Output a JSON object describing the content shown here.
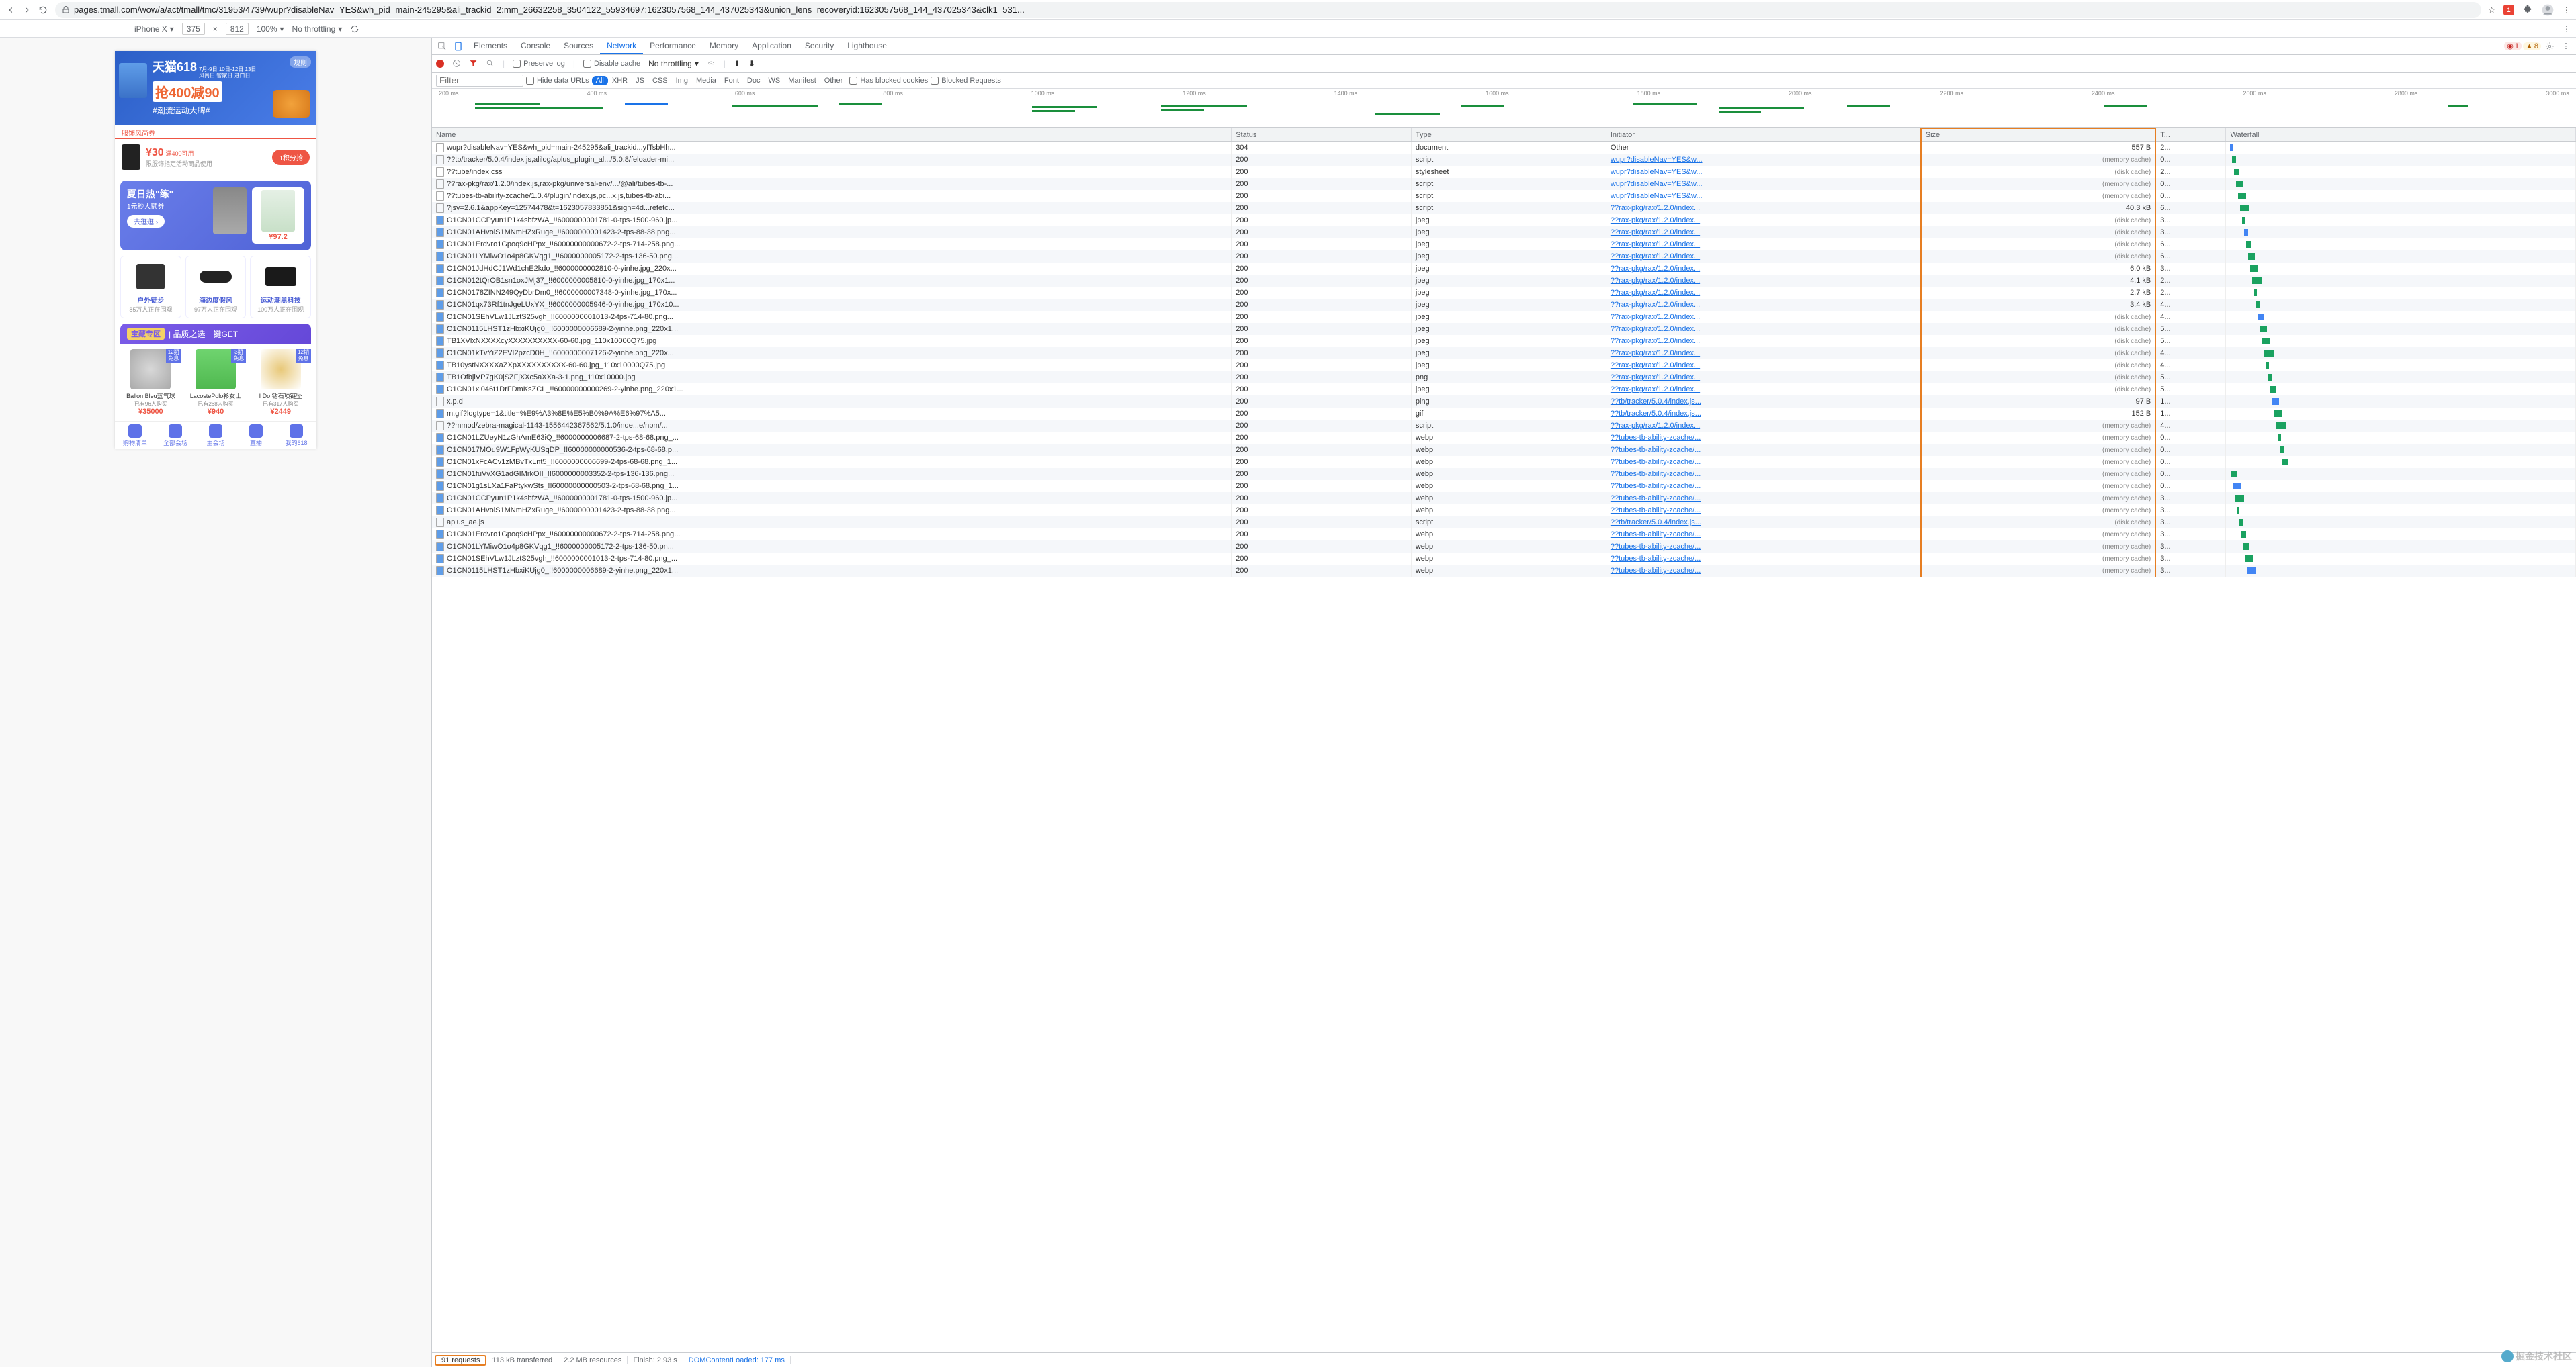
{
  "browser": {
    "url": "pages.tmall.com/wow/a/act/tmall/tmc/31953/4739/wupr?disableNav=YES&wh_pid=main-245295&ali_trackid=2:mm_26632258_3504122_55934697:1623057568_144_437025343&union_lens=recoveryid:1623057568_144_437025343&clk1=531...",
    "ext_badge": "1"
  },
  "device_bar": {
    "device": "iPhone X",
    "width": "375",
    "height": "812",
    "zoom": "100%",
    "throttling": "No throttling"
  },
  "devtools": {
    "tabs": [
      "Elements",
      "Console",
      "Sources",
      "Network",
      "Performance",
      "Memory",
      "Application",
      "Security",
      "Lighthouse"
    ],
    "active_tab": "Network",
    "errors": "1",
    "warnings": "8",
    "preserve_log": "Preserve log",
    "disable_cache": "Disable cache",
    "throttling": "No throttling",
    "hide_data_urls": "Hide data URLs",
    "filter_types": [
      "All",
      "XHR",
      "JS",
      "CSS",
      "Img",
      "Media",
      "Font",
      "Doc",
      "WS",
      "Manifest",
      "Other"
    ],
    "has_blocked": "Has blocked cookies",
    "blocked_req": "Blocked Requests",
    "filter_placeholder": "Filter"
  },
  "overview_ticks": [
    "200 ms",
    "400 ms",
    "600 ms",
    "800 ms",
    "1000 ms",
    "1200 ms",
    "1400 ms",
    "1600 ms",
    "1800 ms",
    "2000 ms",
    "2200 ms",
    "2400 ms",
    "2600 ms",
    "2800 ms",
    "3000 ms"
  ],
  "columns": {
    "name": "Name",
    "status": "Status",
    "type": "Type",
    "initiator": "Initiator",
    "size": "Size",
    "time": "T...",
    "waterfall": "Waterfall"
  },
  "rows": [
    {
      "name": "wupr?disableNav=YES&wh_pid=main-245295&ali_trackid...yfTsbHh...",
      "status": "304",
      "type": "document",
      "init": "Other",
      "init_link": false,
      "size": "557 B",
      "time": "2...",
      "icon": ""
    },
    {
      "name": "??tb/tracker/5.0.4/index.js,alilog/aplus_plugin_al.../5.0.8/feloader-mi...",
      "status": "200",
      "type": "script",
      "init": "wupr?disableNav=YES&w...",
      "init_link": true,
      "size": "(memory cache)",
      "time": "0...",
      "icon": ""
    },
    {
      "name": "??tube/index.css",
      "status": "200",
      "type": "stylesheet",
      "init": "wupr?disableNav=YES&w...",
      "init_link": true,
      "size": "(disk cache)",
      "time": "2...",
      "icon": ""
    },
    {
      "name": "??rax-pkg/rax/1.2.0/index.js,rax-pkg/universal-env/.../@ali/tubes-tb-...",
      "status": "200",
      "type": "script",
      "init": "wupr?disableNav=YES&w...",
      "init_link": true,
      "size": "(memory cache)",
      "time": "0...",
      "icon": ""
    },
    {
      "name": "??tubes-tb-ability-zcache/1.0.4/plugin/index.js,pc...x.js,tubes-tb-abi...",
      "status": "200",
      "type": "script",
      "init": "wupr?disableNav=YES&w...",
      "init_link": true,
      "size": "(memory cache)",
      "time": "0...",
      "icon": ""
    },
    {
      "name": "?jsv=2.6.1&appKey=12574478&t=1623057833851&sign=4d...refetc...",
      "status": "200",
      "type": "script",
      "init": "??rax-pkg/rax/1.2.0/index...",
      "init_link": true,
      "size": "40.3 kB",
      "time": "6...",
      "icon": ""
    },
    {
      "name": "O1CN01CCPyun1P1k4sbfzWA_!!6000000001781-0-tps-1500-960.jp...",
      "status": "200",
      "type": "jpeg",
      "init": "??rax-pkg/rax/1.2.0/index...",
      "init_link": true,
      "size": "(disk cache)",
      "time": "3...",
      "icon": "img"
    },
    {
      "name": "O1CN01AHvolS1MNmHZxRuge_!!6000000001423-2-tps-88-38.png...",
      "status": "200",
      "type": "jpeg",
      "init": "??rax-pkg/rax/1.2.0/index...",
      "init_link": true,
      "size": "(disk cache)",
      "time": "3...",
      "icon": "img"
    },
    {
      "name": "O1CN01Erdvro1Gpoq9cHPpx_!!60000000000672-2-tps-714-258.png...",
      "status": "200",
      "type": "jpeg",
      "init": "??rax-pkg/rax/1.2.0/index...",
      "init_link": true,
      "size": "(disk cache)",
      "time": "6...",
      "icon": "img"
    },
    {
      "name": "O1CN01LYMiwO1o4p8GKVqg1_!!6000000005172-2-tps-136-50.png...",
      "status": "200",
      "type": "jpeg",
      "init": "??rax-pkg/rax/1.2.0/index...",
      "init_link": true,
      "size": "(disk cache)",
      "time": "6...",
      "icon": "img"
    },
    {
      "name": "O1CN01JdHdCJ1Wd1chE2kdo_!!6000000002810-0-yinhe.jpg_220x...",
      "status": "200",
      "type": "jpeg",
      "init": "??rax-pkg/rax/1.2.0/index...",
      "init_link": true,
      "size": "6.0 kB",
      "time": "3...",
      "icon": "img"
    },
    {
      "name": "O1CN012tQrOB1sn1oxJMj37_!!6000000005810-0-yinhe.jpg_170x1...",
      "status": "200",
      "type": "jpeg",
      "init": "??rax-pkg/rax/1.2.0/index...",
      "init_link": true,
      "size": "4.1 kB",
      "time": "2...",
      "icon": "img"
    },
    {
      "name": "O1CN0178ZINN249QyDbrDm0_!!6000000007348-0-yinhe.jpg_170x...",
      "status": "200",
      "type": "jpeg",
      "init": "??rax-pkg/rax/1.2.0/index...",
      "init_link": true,
      "size": "2.7 kB",
      "time": "2...",
      "icon": "img"
    },
    {
      "name": "O1CN01qx73Rf1tnJgeLUxYX_!!6000000005946-0-yinhe.jpg_170x10...",
      "status": "200",
      "type": "jpeg",
      "init": "??rax-pkg/rax/1.2.0/index...",
      "init_link": true,
      "size": "3.4 kB",
      "time": "4...",
      "icon": "img"
    },
    {
      "name": "O1CN01SEhVLw1JLztS25vgh_!!6000000001013-2-tps-714-80.png...",
      "status": "200",
      "type": "jpeg",
      "init": "??rax-pkg/rax/1.2.0/index...",
      "init_link": true,
      "size": "(disk cache)",
      "time": "4...",
      "icon": "img"
    },
    {
      "name": "O1CN0115LHST1zHbxiKUjg0_!!6000000006689-2-yinhe.png_220x1...",
      "status": "200",
      "type": "jpeg",
      "init": "??rax-pkg/rax/1.2.0/index...",
      "init_link": true,
      "size": "(disk cache)",
      "time": "5...",
      "icon": "img"
    },
    {
      "name": "TB1XVlxNXXXXcyXXXXXXXXXX-60-60.jpg_110x10000Q75.jpg",
      "status": "200",
      "type": "jpeg",
      "init": "??rax-pkg/rax/1.2.0/index...",
      "init_link": true,
      "size": "(disk cache)",
      "time": "5...",
      "icon": "img"
    },
    {
      "name": "O1CN01kTvYiZ2EVI2pzcD0H_!!6000000007126-2-yinhe.png_220x...",
      "status": "200",
      "type": "jpeg",
      "init": "??rax-pkg/rax/1.2.0/index...",
      "init_link": true,
      "size": "(disk cache)",
      "time": "4...",
      "icon": "img"
    },
    {
      "name": "TB10ystNXXXXaZXpXXXXXXXXXX-60-60.jpg_110x10000Q75.jpg",
      "status": "200",
      "type": "jpeg",
      "init": "??rax-pkg/rax/1.2.0/index...",
      "init_link": true,
      "size": "(disk cache)",
      "time": "4...",
      "icon": "img"
    },
    {
      "name": "TB1OfbjiVP7gK0jSZFjXXc5aXXa-3-1.png_110x10000.jpg",
      "status": "200",
      "type": "png",
      "init": "??rax-pkg/rax/1.2.0/index...",
      "init_link": true,
      "size": "(disk cache)",
      "time": "5...",
      "icon": "img"
    },
    {
      "name": "O1CN01xi046t1DrFDmKsZCL_!!60000000000269-2-yinhe.png_220x1...",
      "status": "200",
      "type": "jpeg",
      "init": "??rax-pkg/rax/1.2.0/index...",
      "init_link": true,
      "size": "(disk cache)",
      "time": "5...",
      "icon": "img"
    },
    {
      "name": "x.p.d",
      "status": "200",
      "type": "ping",
      "init": "??tb/tracker/5.0.4/index.js...",
      "init_link": true,
      "size": "97 B",
      "time": "1...",
      "icon": ""
    },
    {
      "name": "m.gif?logtype=1&title=%E9%A3%8E%E5%B0%9A%E6%97%A5...",
      "status": "200",
      "type": "gif",
      "init": "??tb/tracker/5.0.4/index.js...",
      "init_link": true,
      "size": "152 B",
      "time": "1...",
      "icon": "img"
    },
    {
      "name": "??mmod/zebra-magical-1143-1556442367562/5.1.0/inde...e/npm/...",
      "status": "200",
      "type": "script",
      "init": "??rax-pkg/rax/1.2.0/index...",
      "init_link": true,
      "size": "(memory cache)",
      "time": "4...",
      "icon": ""
    },
    {
      "name": "O1CN01LZUeyN1zGhAmE63iQ_!!6000000006687-2-tps-68-68.png_...",
      "status": "200",
      "type": "webp",
      "init": "??tubes-tb-ability-zcache/...",
      "init_link": true,
      "size": "(memory cache)",
      "time": "0...",
      "icon": "img"
    },
    {
      "name": "O1CN017MOu9W1FpWyKUSqDP_!!60000000000536-2-tps-68-68.p...",
      "status": "200",
      "type": "webp",
      "init": "??tubes-tb-ability-zcache/...",
      "init_link": true,
      "size": "(memory cache)",
      "time": "0...",
      "icon": "img"
    },
    {
      "name": "O1CN01xFcACv1zMBvTxLnt5_!!6000000006699-2-tps-68-68.png_1...",
      "status": "200",
      "type": "webp",
      "init": "??tubes-tb-ability-zcache/...",
      "init_link": true,
      "size": "(memory cache)",
      "time": "0...",
      "icon": "img"
    },
    {
      "name": "O1CN01fuVvXG1adGIMrkOII_!!6000000003352-2-tps-136-136.png...",
      "status": "200",
      "type": "webp",
      "init": "??tubes-tb-ability-zcache/...",
      "init_link": true,
      "size": "(memory cache)",
      "time": "0...",
      "icon": "img"
    },
    {
      "name": "O1CN01g1sLXa1FaPtykwSts_!!60000000000503-2-tps-68-68.png_1...",
      "status": "200",
      "type": "webp",
      "init": "??tubes-tb-ability-zcache/...",
      "init_link": true,
      "size": "(memory cache)",
      "time": "0...",
      "icon": "img"
    },
    {
      "name": "O1CN01CCPyun1P1k4sbfzWA_!!6000000001781-0-tps-1500-960.jp...",
      "status": "200",
      "type": "webp",
      "init": "??tubes-tb-ability-zcache/...",
      "init_link": true,
      "size": "(memory cache)",
      "time": "3...",
      "icon": "img"
    },
    {
      "name": "O1CN01AHvolS1MNmHZxRuge_!!6000000001423-2-tps-88-38.png...",
      "status": "200",
      "type": "webp",
      "init": "??tubes-tb-ability-zcache/...",
      "init_link": true,
      "size": "(memory cache)",
      "time": "3...",
      "icon": "img"
    },
    {
      "name": "aplus_ae.js",
      "status": "200",
      "type": "script",
      "init": "??tb/tracker/5.0.4/index.js...",
      "init_link": true,
      "size": "(disk cache)",
      "time": "3...",
      "icon": ""
    },
    {
      "name": "O1CN01Erdvro1Gpoq9cHPpx_!!60000000000672-2-tps-714-258.png...",
      "status": "200",
      "type": "webp",
      "init": "??tubes-tb-ability-zcache/...",
      "init_link": true,
      "size": "(memory cache)",
      "time": "3...",
      "icon": "img"
    },
    {
      "name": "O1CN01LYMiwO1o4p8GKVqg1_!!6000000005172-2-tps-136-50.pn...",
      "status": "200",
      "type": "webp",
      "init": "??tubes-tb-ability-zcache/...",
      "init_link": true,
      "size": "(memory cache)",
      "time": "3...",
      "icon": "img"
    },
    {
      "name": "O1CN01SEhVLw1JLztS25vgh_!!6000000001013-2-tps-714-80.png_...",
      "status": "200",
      "type": "webp",
      "init": "??tubes-tb-ability-zcache/...",
      "init_link": true,
      "size": "(memory cache)",
      "time": "3...",
      "icon": "img"
    },
    {
      "name": "O1CN0115LHST1zHbxiKUjg0_!!6000000006689-2-yinhe.png_220x1...",
      "status": "200",
      "type": "webp",
      "init": "??tubes-tb-ability-zcache/...",
      "init_link": true,
      "size": "(memory cache)",
      "time": "3...",
      "icon": "img"
    }
  ],
  "status_bar": {
    "requests": "91 requests",
    "transferred": "113 kB transferred",
    "resources": "2.2 MB resources",
    "finish": "Finish: 2.93 s",
    "dom": "DOMContentLoaded: 177 ms"
  },
  "phone": {
    "banner": {
      "rules": "规则",
      "logo": "天猫618",
      "dates": "7月-9日 10日-12日 13日",
      "sub_dates": "风尚日 智家日 进口日",
      "main": "抢400减90",
      "tag": "#潮流运动大牌#"
    },
    "coupon": {
      "tag": "服饰风尚券",
      "price": "¥30",
      "cond": "满400可用",
      "desc": "限服饰指定活动商品使用",
      "btn": "1积分抢"
    },
    "training": {
      "title": "夏日热\"练\"",
      "sub": "1元秒大额券",
      "go": "去逛逛 ›",
      "price": "¥97.2"
    },
    "cats": [
      {
        "title": "户外徒步",
        "sub": "85万人正在围观"
      },
      {
        "title": "海边度假风",
        "sub": "97万人正在围观"
      },
      {
        "title": "运动潮黑科技",
        "sub": "100万人正在围观"
      }
    ],
    "treasure": {
      "badge": "宝藏专区",
      "text": "品质之选一键GET"
    },
    "products": [
      {
        "badge": "12期\n免息",
        "name": "Ballon Bleu蓝气球",
        "buyers": "已有96人购买",
        "price": "¥35000"
      },
      {
        "badge": "3期\n免息",
        "name": "LacostePolo衫女士",
        "buyers": "已有268人购买",
        "price": "¥940"
      },
      {
        "badge": "12期\n免息",
        "name": "I Do 钻石项链坠",
        "buyers": "已有317人购买",
        "price": "¥2449"
      }
    ],
    "tabs": [
      "购物清单",
      "全部会场",
      "主会场",
      "直播",
      "我的618"
    ]
  },
  "watermark": "掘金技术社区"
}
